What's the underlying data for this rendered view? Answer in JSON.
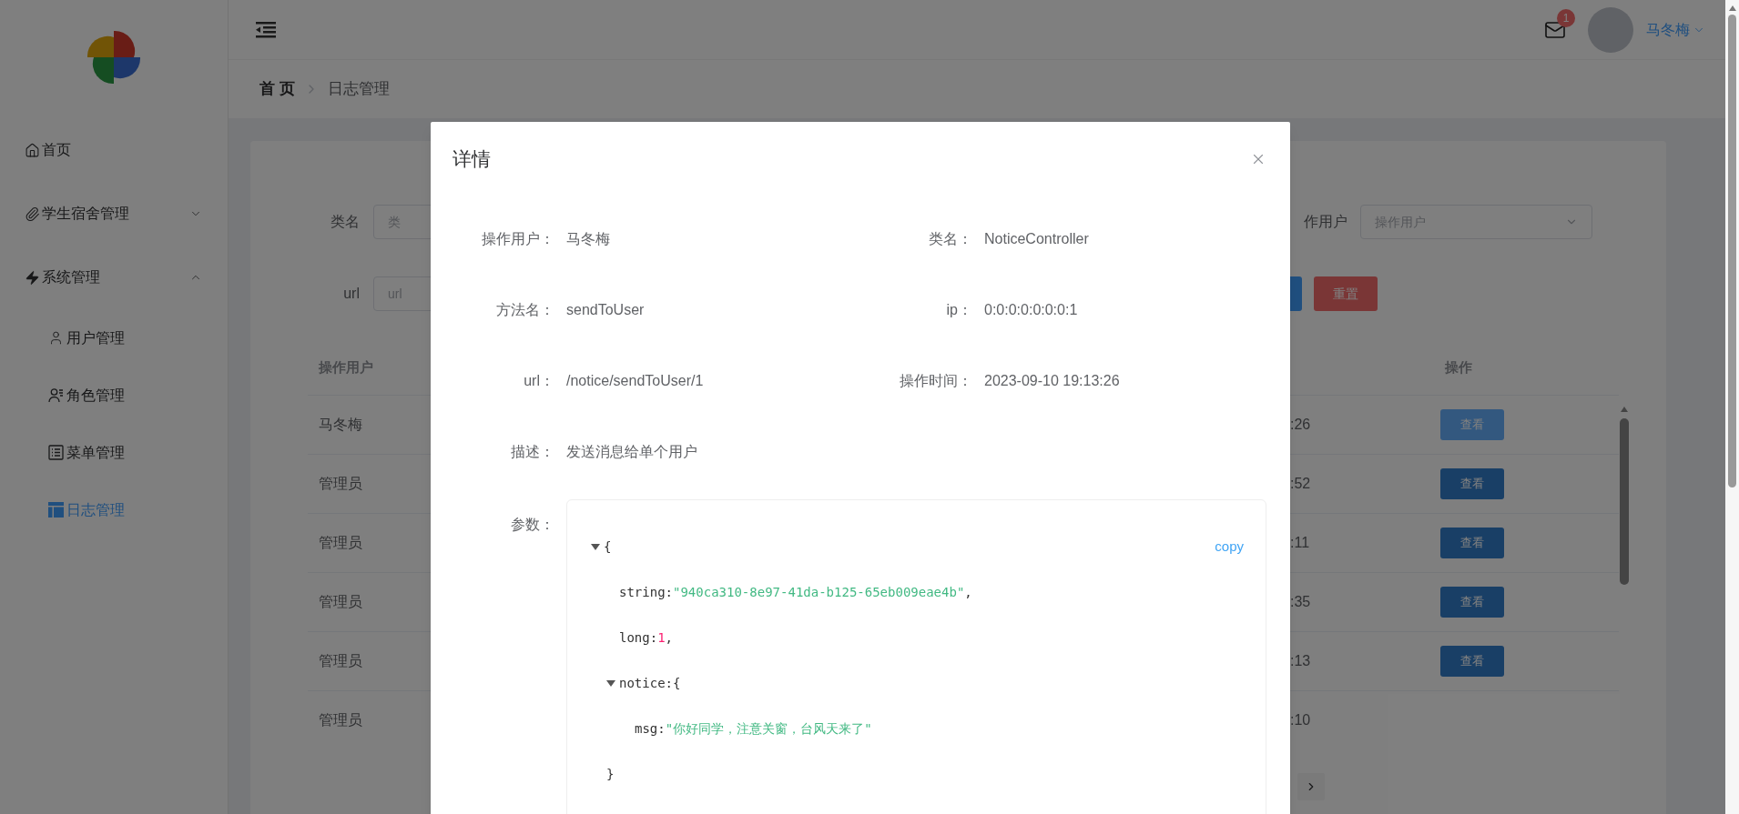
{
  "sidebar": {
    "menu": [
      {
        "label": "首页",
        "selected": false
      },
      {
        "label": "学生宿舍管理",
        "selected": false,
        "expanded": false
      },
      {
        "label": "系统管理",
        "selected": false,
        "expanded": true,
        "children": [
          {
            "label": "用户管理",
            "selected": false
          },
          {
            "label": "角色管理",
            "selected": false
          },
          {
            "label": "菜单管理",
            "selected": false
          },
          {
            "label": "日志管理",
            "selected": true
          }
        ]
      }
    ]
  },
  "header": {
    "breadcrumb": [
      "首 页",
      "日志管理"
    ],
    "notifications": {
      "count": "1"
    },
    "user": {
      "name": "马冬梅"
    }
  },
  "filters": {
    "fields": [
      {
        "label": "类名",
        "placeholder": "类"
      },
      {
        "label": "url",
        "placeholder": "url"
      }
    ],
    "user_filter": {
      "label": "作用户",
      "placeholder": "操作用户"
    },
    "buttons": [
      {
        "kind": "primary"
      },
      {
        "kind": "danger",
        "label": "重置"
      }
    ]
  },
  "table": {
    "columns": [
      "操作用户",
      "操作"
    ],
    "rows": [
      {
        "user": "马冬梅",
        "time": ":26",
        "action": "查看",
        "hovered": true
      },
      {
        "user": "管理员",
        "time": ":52",
        "action": "查看",
        "hovered": false
      },
      {
        "user": "管理员",
        "time": ":11",
        "action": "查看",
        "hovered": false
      },
      {
        "user": "管理员",
        "time": ":35",
        "action": "查看",
        "hovered": false
      },
      {
        "user": "管理员",
        "time": ":13",
        "action": "查看",
        "hovered": false
      },
      {
        "user": "管理员",
        "time": ":10"
      }
    ]
  },
  "modal": {
    "title": "详情",
    "fields": [
      {
        "label": "操作用户：",
        "value": "马冬梅"
      },
      {
        "label": "类名：",
        "value": "NoticeController"
      },
      {
        "label": "方法名：",
        "value": "sendToUser"
      },
      {
        "label": "ip：",
        "value": "0:0:0:0:0:0:0:1"
      },
      {
        "label": "url：",
        "value": "/notice/sendToUser/1"
      },
      {
        "label": "操作时间：",
        "value": "2023-09-10 19:13:26"
      },
      {
        "label": "描述：",
        "value": "发送消息给单个用户"
      }
    ],
    "params": {
      "label": "参数：",
      "copy": "copy",
      "tree": {
        "kind": "object",
        "open": "{",
        "expanded": true,
        "children": [
          {
            "kind": "string",
            "key": "string:",
            "value": "\"940ca310-8e97-41da-b125-65eb009eae4b\"",
            "comma": ","
          },
          {
            "kind": "number",
            "key": "long:",
            "value": "1",
            "comma": ","
          },
          {
            "kind": "object",
            "key": "notice:",
            "open": "{",
            "close": "}",
            "expanded": true,
            "children": [
              {
                "kind": "string",
                "key": "msg:",
                "value": "\"你好同学，注意关窗，台风天来了\""
              }
            ]
          }
        ]
      }
    }
  }
}
